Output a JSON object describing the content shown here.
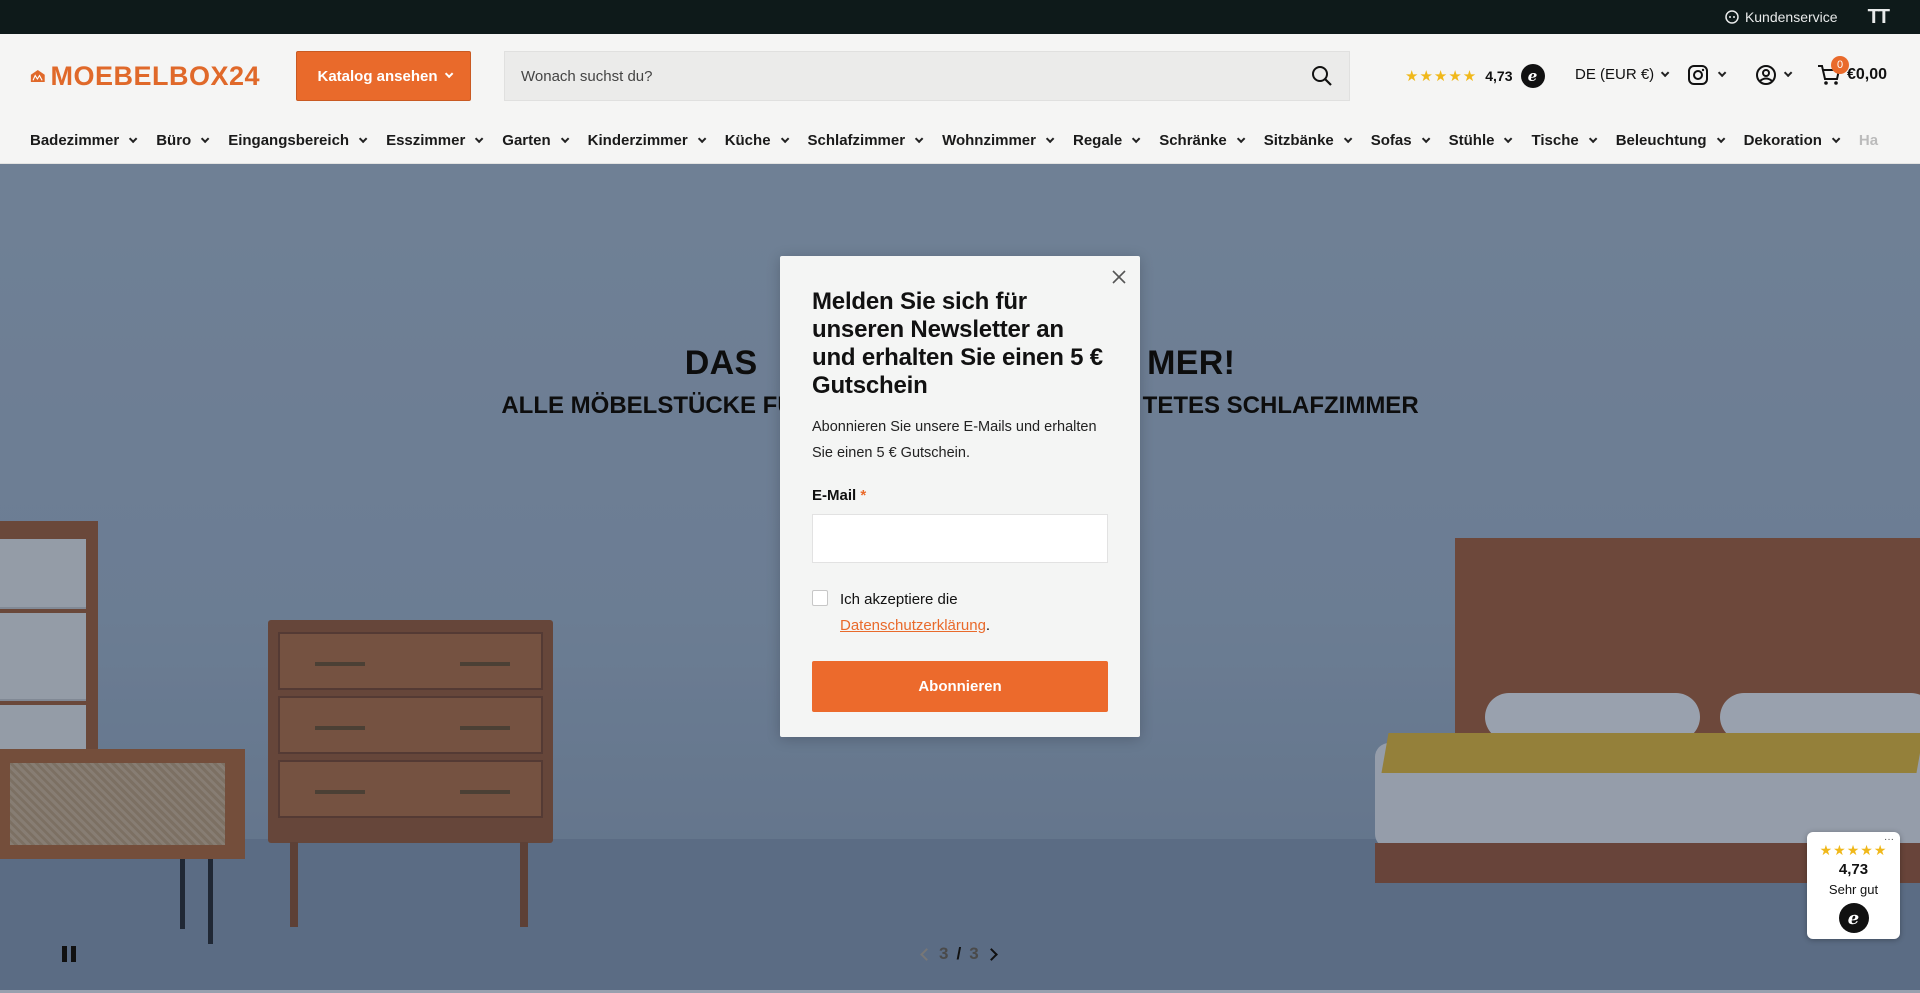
{
  "topbar": {
    "service_label": "Kundenservice",
    "text_size_label": "TT"
  },
  "header": {
    "logo_text": "MOEBELBOX24",
    "catalog_label": "Katalog ansehen",
    "search_placeholder": "Wonach suchst du?",
    "rating_value": "4,73",
    "rating_stars": "★★★★★",
    "locale_label": "DE (EUR €)",
    "cart_count": "0",
    "cart_total": "€0,00"
  },
  "nav": {
    "items": [
      "Badezimmer",
      "Büro",
      "Eingangsbereich",
      "Esszimmer",
      "Garten",
      "Kinderzimmer",
      "Küche",
      "Schlafzimmer",
      "Wohnzimmer",
      "Regale",
      "Schränke",
      "Sitzbänke",
      "Sofas",
      "Stühle",
      "Tische",
      "Beleuchtung",
      "Dekoration"
    ],
    "faded_item": "Ha"
  },
  "hero": {
    "title_left": "DAS ",
    "title_right": "MER!",
    "sub_left": "ALLE MÖBELSTÜCKE FÜ",
    "sub_right": "TETES SCHLAFZIMMER",
    "slide_current": "3",
    "slide_total": "3",
    "slide_sep": "/"
  },
  "modal": {
    "title": "Melden Sie sich für unseren Newsletter an und erhalten Sie einen 5 € Gutschein",
    "description": "Abonnieren Sie unsere E-Mails und erhalten Sie einen 5 € Gutschein.",
    "email_label": "E-Mail",
    "required_mark": "*",
    "email_value": "",
    "consent_text": "Ich akzeptiere die",
    "consent_link": "Datenschutzerklärung",
    "consent_end": ".",
    "submit_label": "Abonnieren"
  },
  "badge": {
    "stars": "★★★★★",
    "score": "4,73",
    "verdict": "Sehr gut",
    "more": "···"
  },
  "colors": {
    "accent": "#e96a2b",
    "topbar_bg": "#0e1a1a",
    "star": "#f0b81a"
  }
}
